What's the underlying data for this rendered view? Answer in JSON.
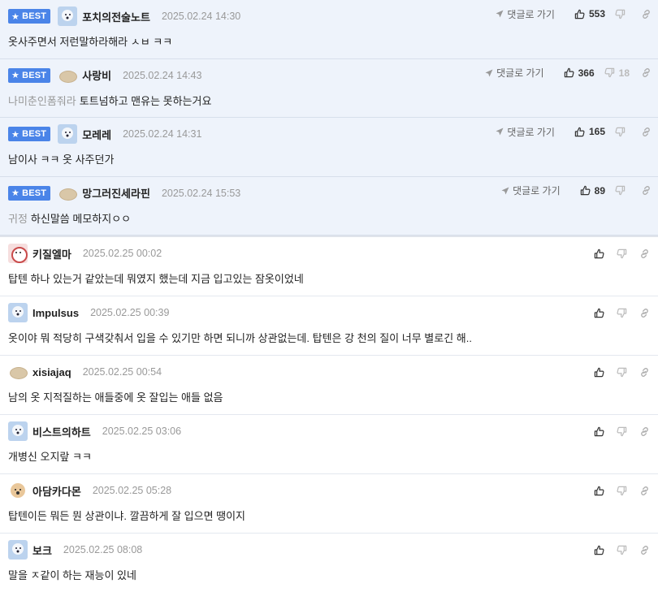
{
  "ui": {
    "best_label": "BEST",
    "goto_label": "댓글로 가기"
  },
  "colors": {
    "best_bg": "#eef3fb",
    "badge": "#4a84e8",
    "muted": "#999999"
  },
  "comments": [
    {
      "best": true,
      "avatar": "bear",
      "nick": "포치의전술노트",
      "time": "2025.02.24 14:30",
      "mention": "",
      "text": "옷사주면서 저런말하라해라 ㅅㅂ ㅋㅋ",
      "up": "553",
      "down": ""
    },
    {
      "best": true,
      "avatar": "potato",
      "nick": "사랑비",
      "time": "2025.02.24 14:43",
      "mention": "나미춘인폼줘라",
      "text": "토트넘하고 맨유는 못하는거요",
      "up": "366",
      "down": "18"
    },
    {
      "best": true,
      "avatar": "bear",
      "nick": "모레레",
      "time": "2025.02.24 14:31",
      "mention": "",
      "text": "남이사 ㅋㅋ 옷 사주던가",
      "up": "165",
      "down": ""
    },
    {
      "best": true,
      "avatar": "potato",
      "nick": "망그러진세라핀",
      "time": "2025.02.24 15:53",
      "mention": "귀정",
      "text": "하신말씀 메모하지ㅇㅇ",
      "up": "89",
      "down": ""
    },
    {
      "best": false,
      "avatar": "red",
      "nick": "키질엘마",
      "time": "2025.02.25 00:02",
      "mention": "",
      "text": "탑텐 하나 있는거 같았는데 뭐였지 했는데 지금 입고있는 잠옷이었네"
    },
    {
      "best": false,
      "avatar": "bear",
      "nick": "Impulsus",
      "time": "2025.02.25 00:39",
      "mention": "",
      "text": "옷이야 뭐 적당히 구색갖춰서 입을 수 있기만 하면 되니까 상관없는데. 탑텐은 강 천의 질이 너무 별로긴 해.."
    },
    {
      "best": false,
      "avatar": "potato",
      "nick": "xisiajaq",
      "time": "2025.02.25 00:54",
      "mention": "",
      "text": "남의 옷 지적질하는 애들중에 옷 잘입는 애들 없음"
    },
    {
      "best": false,
      "avatar": "bear",
      "nick": "비스트의하트",
      "time": "2025.02.25 03:06",
      "mention": "",
      "text": "개병신 오지랖 ㅋㅋ"
    },
    {
      "best": false,
      "avatar": "dog",
      "nick": "아담카다몬",
      "time": "2025.02.25 05:28",
      "mention": "",
      "text": "탑텐이든 뭐든 뭔 상관이냐. 깔끔하게 잘 입으면 땡이지"
    },
    {
      "best": false,
      "avatar": "bear",
      "nick": "보크",
      "time": "2025.02.25 08:08",
      "mention": "",
      "text": "말을 ㅈ같이 하는 재능이 있네"
    }
  ]
}
